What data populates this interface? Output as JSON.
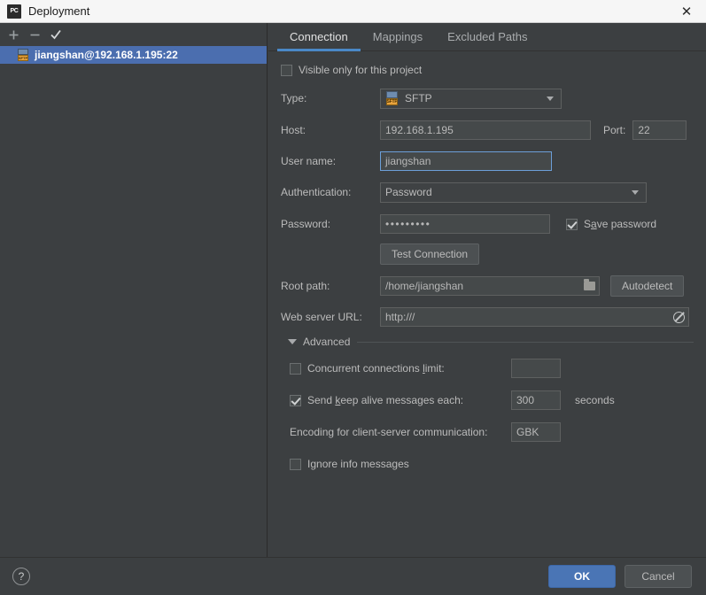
{
  "window": {
    "title": "Deployment",
    "app_icon": "PC",
    "close_icon": "close-icon"
  },
  "left_panel": {
    "toolbar": [
      {
        "name": "add-server-button",
        "glyph": "+"
      },
      {
        "name": "remove-server-button",
        "glyph": "−"
      },
      {
        "name": "set-default-server-button",
        "glyph": "✔"
      }
    ],
    "servers": [
      {
        "label": "jiangshan@192.168.1.195:22",
        "icon": "sftp-icon",
        "selected": true
      }
    ]
  },
  "tabs": [
    {
      "label": "Connection",
      "active": true
    },
    {
      "label": "Mappings",
      "active": false
    },
    {
      "label": "Excluded Paths",
      "active": false
    }
  ],
  "connection": {
    "visible_only_checkbox": {
      "label": "Visible only for this project",
      "checked": false
    },
    "type": {
      "label": "Type:",
      "value": "SFTP",
      "icon_text": "SFTP"
    },
    "host": {
      "label": "Host:",
      "value": "192.168.1.195"
    },
    "port": {
      "label": "Port:",
      "value": "22"
    },
    "user_name": {
      "label": "User name:",
      "value": "jiangshan"
    },
    "authentication": {
      "label": "Authentication:",
      "value": "Password"
    },
    "password": {
      "label": "Password:",
      "value": "•••••••••"
    },
    "save_password": {
      "label_pre": "S",
      "label_mnemonic": "a",
      "label_post": "ve password",
      "checked": true
    },
    "test_connection_button": "Test Connection",
    "root_path": {
      "label": "Root path:",
      "value": "/home/jiangshan",
      "icon": "folder-icon"
    },
    "autodetect_button": "Autodetect",
    "web_server_url": {
      "label": "Web server URL:",
      "value": "http:///",
      "icon": "globe-disabled-icon"
    }
  },
  "advanced": {
    "header": "Advanced",
    "collapse_icon": "chevron-down-icon",
    "concurrent_limit": {
      "label_pre": "Concurrent connections ",
      "label_mnemonic": "l",
      "label_post": "imit:",
      "checked": false,
      "value": ""
    },
    "keep_alive": {
      "label_pre": "Send ",
      "label_mnemonic": "k",
      "label_post": "eep alive messages each:",
      "checked": true,
      "value": "300",
      "unit": "seconds"
    },
    "encoding": {
      "label": "Encoding for client-server communication:",
      "value": "GBK"
    },
    "ignore_info": {
      "label_pre": "I",
      "label_mnemonic": "g",
      "label_post": "nore info messages",
      "checked": false
    }
  },
  "bottom": {
    "help_icon": "?",
    "ok_label": "OK",
    "cancel_label": "Cancel"
  },
  "colors": {
    "panel_bg": "#3c3f41",
    "selection_blue": "#4b6eaf",
    "accent_blue": "#4a88c7",
    "ok_button": "#4a75b5",
    "field_bg": "#45494a",
    "text": "#bbbbbb"
  }
}
